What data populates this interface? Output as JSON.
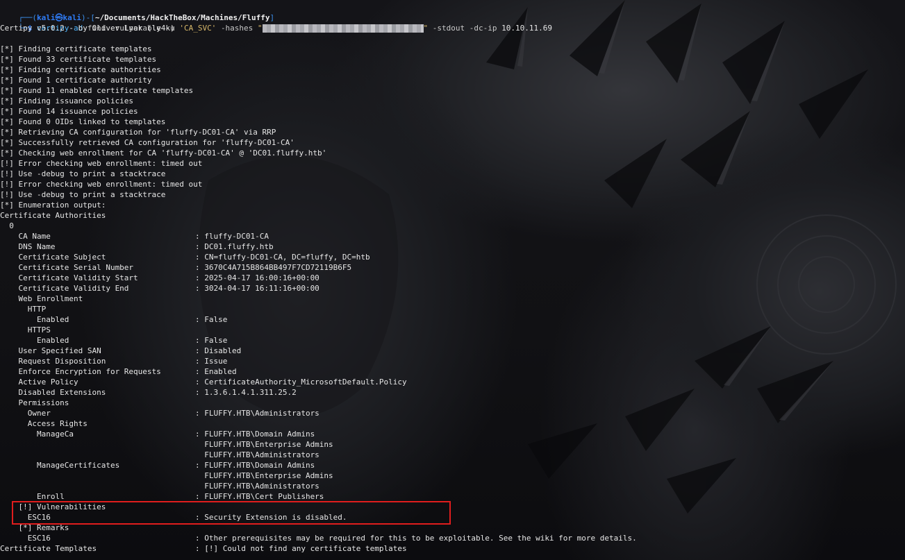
{
  "prompt": {
    "corner_top": "┌──(",
    "user_host": "kali㉿kali",
    "close_user": ")-[",
    "path": "~/Documents/HackTheBox/Machines/Fluffy",
    "close_path": "]",
    "corner_bottom": "└─",
    "symbol": "$"
  },
  "command": {
    "name": "certipy-ad",
    "args_a": "find -vulnerable -u",
    "user_arg": "'CA_SVC'",
    "hashes_flag": "-hashes",
    "hash_open": "\"",
    "hash_close": "\"",
    "args_b": "-stdout -dc-ip",
    "ip": "10.10.11.69"
  },
  "lines": [
    {
      "id": "l3",
      "text": "Certipy v5.0.2 - by Oliver Lyak (ly4k)"
    },
    {
      "id": "l5",
      "text": "[*] Finding certificate templates"
    },
    {
      "id": "l6",
      "text": "[*] Found 33 certificate templates"
    },
    {
      "id": "l7",
      "text": "[*] Finding certificate authorities"
    },
    {
      "id": "l8",
      "text": "[*] Found 1 certificate authority"
    },
    {
      "id": "l9",
      "text": "[*] Found 11 enabled certificate templates"
    },
    {
      "id": "l10",
      "text": "[*] Finding issuance policies"
    },
    {
      "id": "l11",
      "text": "[*] Found 14 issuance policies"
    },
    {
      "id": "l12",
      "text": "[*] Found 0 OIDs linked to templates"
    },
    {
      "id": "l13",
      "text": "[*] Retrieving CA configuration for 'fluffy-DC01-CA' via RRP"
    },
    {
      "id": "l14",
      "text": "[*] Successfully retrieved CA configuration for 'fluffy-DC01-CA'"
    },
    {
      "id": "l15",
      "text": "[*] Checking web enrollment for CA 'fluffy-DC01-CA' @ 'DC01.fluffy.htb'"
    },
    {
      "id": "l16",
      "text": "[!] Error checking web enrollment: timed out"
    },
    {
      "id": "l17",
      "text": "[!] Use -debug to print a stacktrace"
    },
    {
      "id": "l18",
      "text": "[!] Error checking web enrollment: timed out"
    },
    {
      "id": "l19",
      "text": "[!] Use -debug to print a stacktrace"
    },
    {
      "id": "l20",
      "text": "[*] Enumeration output:"
    },
    {
      "id": "l21",
      "text": "Certificate Authorities"
    },
    {
      "id": "l22",
      "text": "  0"
    }
  ],
  "kv": [
    {
      "key": "    CA Name",
      "value": ": fluffy-DC01-CA"
    },
    {
      "key": "    DNS Name",
      "value": ": DC01.fluffy.htb"
    },
    {
      "key": "    Certificate Subject",
      "value": ": CN=fluffy-DC01-CA, DC=fluffy, DC=htb"
    },
    {
      "key": "    Certificate Serial Number",
      "value": ": 3670C4A715B864BB497F7CD72119B6F5"
    },
    {
      "key": "    Certificate Validity Start",
      "value": ": 2025-04-17 16:00:16+00:00"
    },
    {
      "key": "    Certificate Validity End",
      "value": ": 3024-04-17 16:11:16+00:00"
    },
    {
      "key": "    Web Enrollment",
      "value": ""
    },
    {
      "key": "      HTTP",
      "value": ""
    },
    {
      "key": "        Enabled",
      "value": ": False"
    },
    {
      "key": "      HTTPS",
      "value": ""
    },
    {
      "key": "        Enabled",
      "value": ": False"
    },
    {
      "key": "    User Specified SAN",
      "value": ": Disabled"
    },
    {
      "key": "    Request Disposition",
      "value": ": Issue"
    },
    {
      "key": "    Enforce Encryption for Requests",
      "value": ": Enabled"
    },
    {
      "key": "    Active Policy",
      "value": ": CertificateAuthority_MicrosoftDefault.Policy"
    },
    {
      "key": "    Disabled Extensions",
      "value": ": 1.3.6.1.4.1.311.25.2"
    },
    {
      "key": "    Permissions",
      "value": ""
    },
    {
      "key": "      Owner",
      "value": ": FLUFFY.HTB\\Administrators"
    },
    {
      "key": "      Access Rights",
      "value": ""
    },
    {
      "key": "        ManageCa",
      "value": ": FLUFFY.HTB\\Domain Admins"
    },
    {
      "key": "",
      "value": "  FLUFFY.HTB\\Enterprise Admins"
    },
    {
      "key": "",
      "value": "  FLUFFY.HTB\\Administrators"
    },
    {
      "key": "        ManageCertificates",
      "value": ": FLUFFY.HTB\\Domain Admins"
    },
    {
      "key": "",
      "value": "  FLUFFY.HTB\\Enterprise Admins"
    },
    {
      "key": "",
      "value": "  FLUFFY.HTB\\Administrators"
    },
    {
      "key": "        Enroll",
      "value": ": FLUFFY.HTB\\Cert Publishers"
    },
    {
      "key": "    [!] Vulnerabilities",
      "value": ""
    },
    {
      "key": "      ESC16",
      "value": ": Security Extension is disabled."
    },
    {
      "key": "    [*] Remarks",
      "value": ""
    },
    {
      "key": "      ESC16",
      "value": ": Other prerequisites may be required for this to be exploitable. See the wiki for more details."
    },
    {
      "key": "Certificate Templates",
      "value": ": [!] Could not find any certificate templates"
    }
  ],
  "colors": {
    "highlight_box": "#e01d1d",
    "prompt_blue": "#2f7cf6",
    "command_blue": "#4fb7ff",
    "string_yellow": "#d7b86a"
  }
}
